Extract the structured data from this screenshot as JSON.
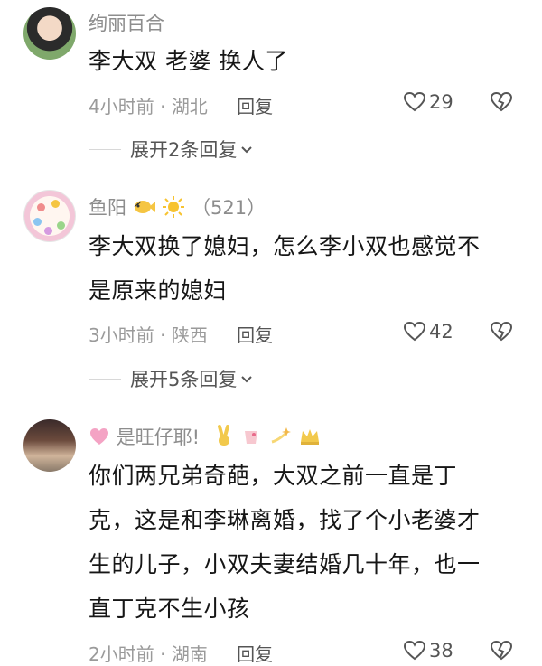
{
  "comments": [
    {
      "username": "绚丽百合",
      "text": [
        "李大双  老婆 换人了"
      ],
      "time": "4小时前",
      "location": "湖北",
      "reply": "回复",
      "likes": "29",
      "expand": "展开2条回复"
    },
    {
      "username": "鱼阳",
      "fans": "（521）",
      "text": [
        "李大双换了媳妇，怎么李小双也感觉不",
        "是原来的媳妇"
      ],
      "time": "3小时前",
      "location": "陕西",
      "reply": "回复",
      "likes": "42",
      "expand": "展开5条回复"
    },
    {
      "username": "是旺仔耶!",
      "text": [
        "你们两兄弟奇葩，大双之前一直是丁",
        "克，这是和李琳离婚，找了个小老婆才",
        "生的儿子，小双夫妻结婚几十年，也一",
        "直丁克不生小孩"
      ],
      "time": "2小时前",
      "location": "湖南",
      "reply": "回复",
      "likes": "38"
    }
  ],
  "separator": "·",
  "icons": {
    "like": "heart-outline-icon",
    "dislike": "broken-heart-icon",
    "expand": "chevron-down-icon"
  }
}
